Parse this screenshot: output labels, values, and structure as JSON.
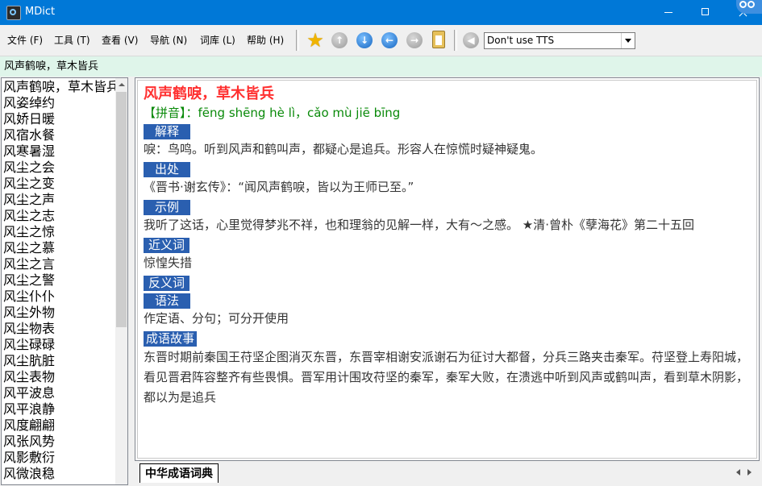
{
  "window": {
    "title": "MDict"
  },
  "menu": [
    {
      "label": "文件 (F)"
    },
    {
      "label": "工具 (T)"
    },
    {
      "label": "查看 (V)"
    },
    {
      "label": "导航 (N)"
    },
    {
      "label": "词库 (L)"
    },
    {
      "label": "帮助 (H)"
    }
  ],
  "toolbar": {
    "icons": [
      "star-icon",
      "up-arrow-icon",
      "down-arrow-icon",
      "back-arrow-icon",
      "forward-arrow-icon",
      "clipboard-icon",
      "speaker-icon"
    ],
    "tts_value": "Don't use TTS"
  },
  "search": {
    "query": "风声鹤唳，草木皆兵"
  },
  "word_list": [
    "风声鹤唳，草木皆兵",
    "风姿绰约",
    "风娇日暖",
    "风宿水餐",
    "风寒暑湿",
    "风尘之会",
    "风尘之变",
    "风尘之声",
    "风尘之志",
    "风尘之惊",
    "风尘之慕",
    "风尘之言",
    "风尘之警",
    "风尘仆仆",
    "风尘外物",
    "风尘物表",
    "风尘碌碌",
    "风尘肮脏",
    "风尘表物",
    "风平波息",
    "风平浪静",
    "风度翩翩",
    "风张风势",
    "风影敷衍",
    "风微浪稳"
  ],
  "entry": {
    "title": "风声鹤唳，草木皆兵",
    "pinyin_label": "【拼音】：",
    "pinyin": "fēng shēng hè lì，cǎo mù jiē bīng",
    "sections": [
      {
        "label": "解释",
        "text": "唳：鸟鸣。听到风声和鹤叫声，都疑心是追兵。形容人在惊慌时疑神疑鬼。"
      },
      {
        "label": "出处",
        "text": "《晋书·谢玄传》：“闻风声鹤唳，皆以为王师已至。”"
      },
      {
        "label": "示例",
        "text": "我听了这话，心里觉得梦兆不祥，也和理翁的见解一样，大有～之感。 ★清·曾朴《孽海花》第二十五回"
      },
      {
        "label": "近义词",
        "text": "惊惶失措"
      },
      {
        "label": "反义词",
        "text": ""
      },
      {
        "label": "语法",
        "text": "作定语、分句；可分开使用"
      },
      {
        "label": "成语故事",
        "text": "东晋时期前秦国王苻坚企图消灭东晋，东晋宰相谢安派谢石为征讨大都督，分兵三路夹击秦军。苻坚登上寿阳城，看见晋君阵容整齐有些畏惧。晋军用计围攻苻坚的秦军，秦军大败，在溃逃中听到风声或鹤叫声，看到草木阴影，都以为是追兵"
      }
    ]
  },
  "tabs": [
    {
      "label": "中华成语词典"
    }
  ],
  "colors": {
    "titlebar": "#0078d7",
    "entry_title": "#ff3030",
    "pinyin": "#0a8a0a",
    "section_label_bg": "#2a5fb0",
    "search_bg": "#dff5ea"
  }
}
